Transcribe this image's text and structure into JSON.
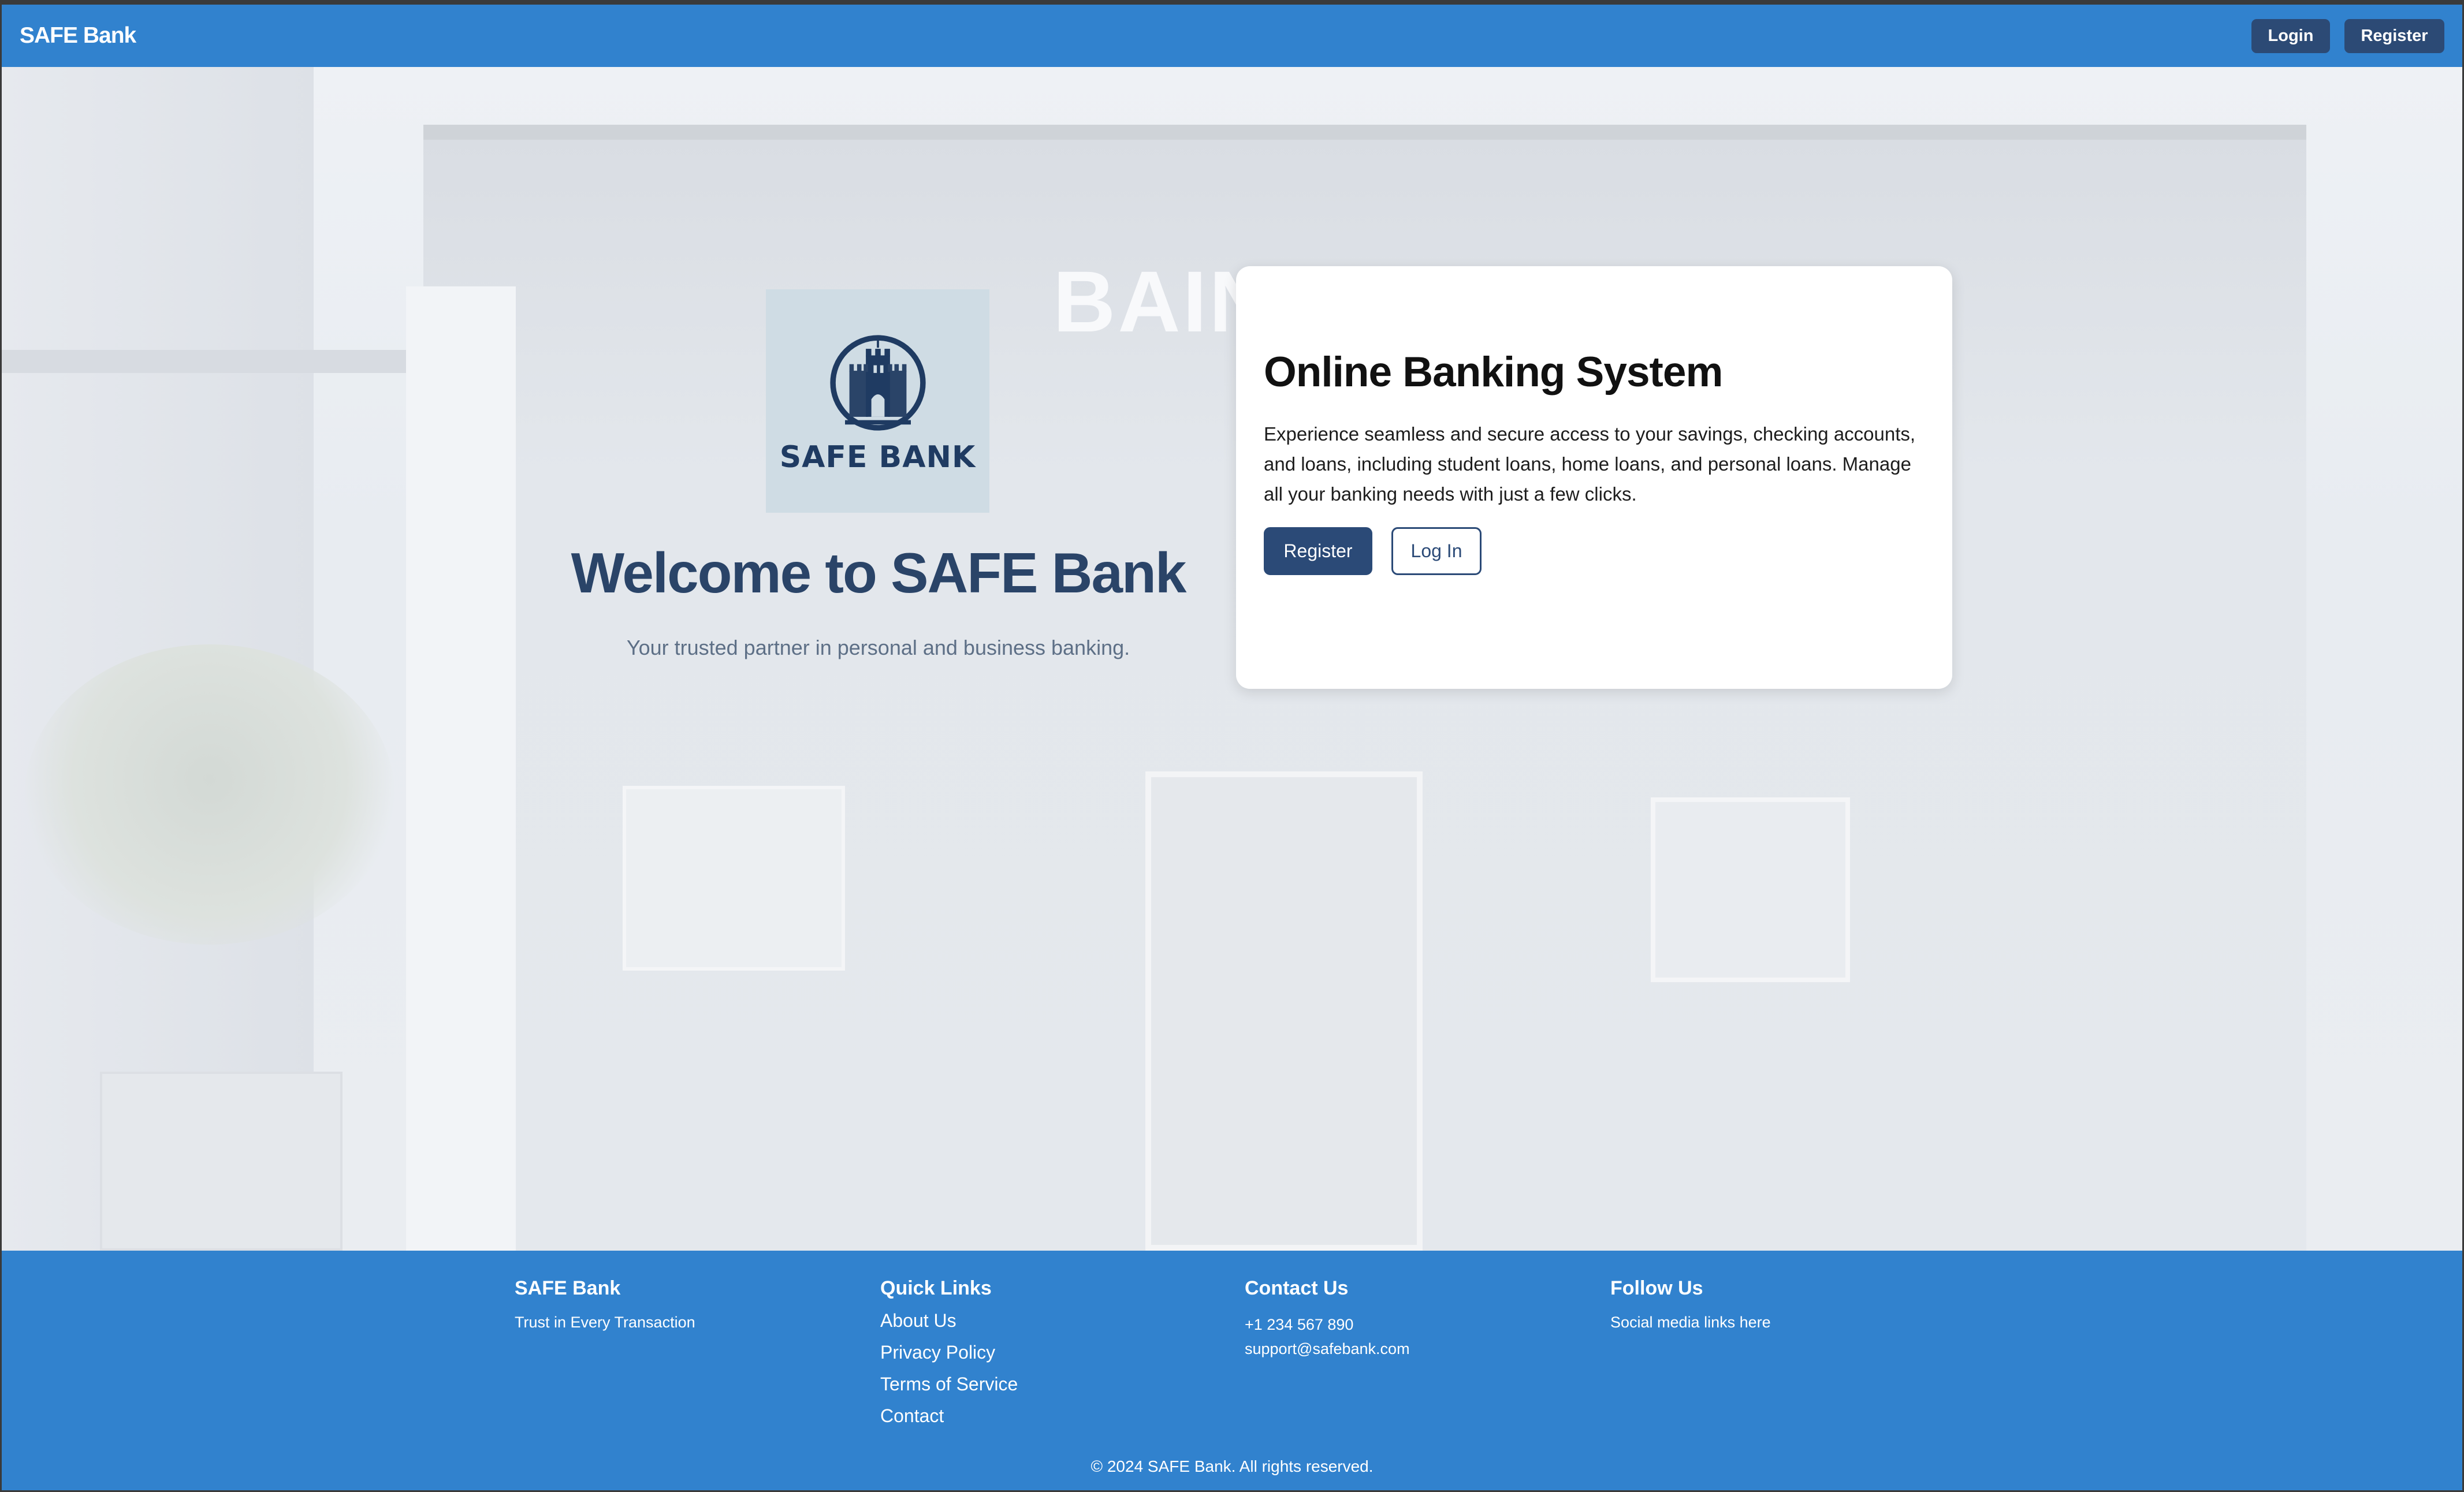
{
  "navbar": {
    "brand": "SAFE Bank",
    "login_label": "Login",
    "register_label": "Register"
  },
  "hero": {
    "logo_text": "SAFE BANK",
    "background_sign": "BAIN",
    "title": "Welcome to SAFE Bank",
    "subtitle": "Your trusted partner in personal and business banking."
  },
  "card": {
    "title": "Online Banking System",
    "description": "Experience seamless and secure access to your savings, checking accounts, and loans, including student loans, home loans, and personal loans. Manage all your banking needs with just a few clicks.",
    "register_label": "Register",
    "login_label": "Log In"
  },
  "footer": {
    "brand": "SAFE Bank",
    "tagline": "Trust in Every Transaction",
    "quick_links_heading": "Quick Links",
    "quick_links": [
      "About Us",
      "Privacy Policy",
      "Terms of Service",
      "Contact"
    ],
    "contact_heading": "Contact Us",
    "phone": "+1 234 567 890",
    "email": "support@safebank.com",
    "follow_heading": "Follow Us",
    "social_text": "Social media links here",
    "copyright": "© 2024 SAFE Bank. All rights reserved."
  },
  "colors": {
    "primary": "#3182ce",
    "dark_button": "#2b4a77",
    "heading": "#2a4468"
  },
  "icons": {
    "logo": "castle-shield-icon"
  }
}
